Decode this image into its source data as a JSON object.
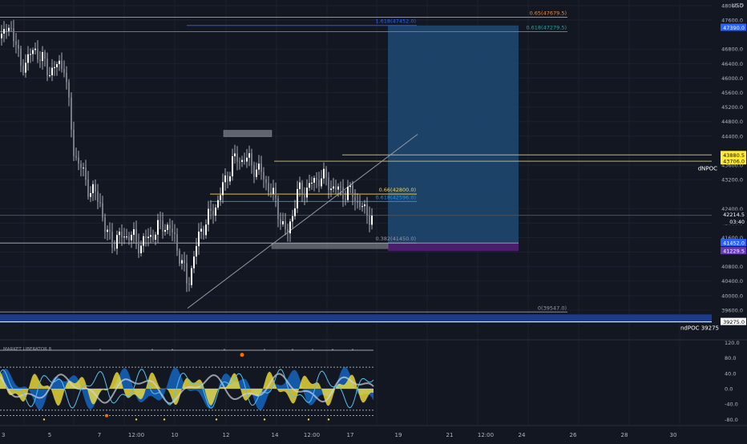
{
  "currency": "USD",
  "chart_data": {
    "type": "candlestick",
    "price_ylim": [
      39200,
      48300
    ],
    "price_ticks": [
      48000,
      47600,
      46800,
      46400,
      46000,
      45600,
      45200,
      44800,
      44400,
      43600,
      43200,
      42400,
      42000,
      41600,
      41200,
      40800,
      40400,
      40000,
      39600
    ],
    "x_ticks": [
      "3",
      "5",
      "7",
      "12:00",
      "10",
      "12",
      "14",
      "12:00",
      "17",
      "19",
      "21",
      "12:00",
      "24",
      "26",
      "28",
      "30"
    ],
    "osc_ticks": [
      "120.0",
      "80.0",
      "40.0",
      "0.0",
      "-40.0",
      "-80.0"
    ],
    "indicator_name": "MARKET LIBERATOR 8",
    "fib_levels": [
      {
        "label": "0.65(47679.5)",
        "price": 47679.5,
        "color": "#f0883e"
      },
      {
        "label": "1.618(47452.0)",
        "price": 47452.0,
        "color": "#2962ff"
      },
      {
        "label": "0.618(47279.5)",
        "price": 47279.5,
        "color": "#26a69a"
      },
      {
        "label": "0.66(42800.0)",
        "price": 42800.0,
        "color": "#f7d154"
      },
      {
        "label": "0.618(42596.0)",
        "price": 42596.0,
        "color": "#2196f3"
      },
      {
        "label": "0.382(41450.0)",
        "price": 41450.0,
        "color": "#9598a1"
      },
      {
        "label": "0(39547.0)",
        "price": 39547.0,
        "color": "#9598a1"
      }
    ],
    "price_badges": [
      {
        "text": "47390.0",
        "bg": "#2962ff",
        "fg": "#ffffff"
      },
      {
        "text": "43880.5",
        "bg": "#ffeb3b",
        "fg": "#000000"
      },
      {
        "text": "43706.0",
        "bg": "#ffeb3b",
        "fg": "#000000"
      },
      {
        "text": "42214.5",
        "bg": "#131722",
        "fg": "#ffffff"
      },
      {
        "text": "03:40",
        "bg": "#131722",
        "fg": "#ffffff"
      },
      {
        "text": "41452.0",
        "bg": "#2962ff",
        "fg": "#ffffff"
      },
      {
        "text": "41229.5",
        "bg": "#673ab7",
        "fg": "#ffffff"
      },
      {
        "text": "39275.0",
        "bg": "#ffffff",
        "fg": "#000000"
      }
    ],
    "poc_labels": {
      "dnpoc": "dNPOC",
      "ndpoc": "ndPOC 39275"
    },
    "colors": {
      "up": "#ffffff",
      "down": "#ffffff",
      "position": "#1e4a74",
      "stop": "#4a1e6b",
      "zone": "#1e3a8a"
    }
  }
}
